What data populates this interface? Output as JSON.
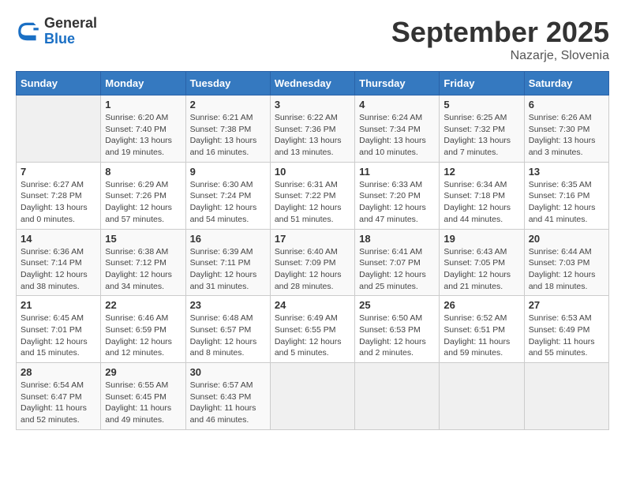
{
  "header": {
    "logo_general": "General",
    "logo_blue": "Blue",
    "month_title": "September 2025",
    "location": "Nazarje, Slovenia"
  },
  "weekdays": [
    "Sunday",
    "Monday",
    "Tuesday",
    "Wednesday",
    "Thursday",
    "Friday",
    "Saturday"
  ],
  "weeks": [
    [
      {
        "day": "",
        "info": ""
      },
      {
        "day": "1",
        "info": "Sunrise: 6:20 AM\nSunset: 7:40 PM\nDaylight: 13 hours and 19 minutes."
      },
      {
        "day": "2",
        "info": "Sunrise: 6:21 AM\nSunset: 7:38 PM\nDaylight: 13 hours and 16 minutes."
      },
      {
        "day": "3",
        "info": "Sunrise: 6:22 AM\nSunset: 7:36 PM\nDaylight: 13 hours and 13 minutes."
      },
      {
        "day": "4",
        "info": "Sunrise: 6:24 AM\nSunset: 7:34 PM\nDaylight: 13 hours and 10 minutes."
      },
      {
        "day": "5",
        "info": "Sunrise: 6:25 AM\nSunset: 7:32 PM\nDaylight: 13 hours and 7 minutes."
      },
      {
        "day": "6",
        "info": "Sunrise: 6:26 AM\nSunset: 7:30 PM\nDaylight: 13 hours and 3 minutes."
      }
    ],
    [
      {
        "day": "7",
        "info": "Sunrise: 6:27 AM\nSunset: 7:28 PM\nDaylight: 13 hours and 0 minutes."
      },
      {
        "day": "8",
        "info": "Sunrise: 6:29 AM\nSunset: 7:26 PM\nDaylight: 12 hours and 57 minutes."
      },
      {
        "day": "9",
        "info": "Sunrise: 6:30 AM\nSunset: 7:24 PM\nDaylight: 12 hours and 54 minutes."
      },
      {
        "day": "10",
        "info": "Sunrise: 6:31 AM\nSunset: 7:22 PM\nDaylight: 12 hours and 51 minutes."
      },
      {
        "day": "11",
        "info": "Sunrise: 6:33 AM\nSunset: 7:20 PM\nDaylight: 12 hours and 47 minutes."
      },
      {
        "day": "12",
        "info": "Sunrise: 6:34 AM\nSunset: 7:18 PM\nDaylight: 12 hours and 44 minutes."
      },
      {
        "day": "13",
        "info": "Sunrise: 6:35 AM\nSunset: 7:16 PM\nDaylight: 12 hours and 41 minutes."
      }
    ],
    [
      {
        "day": "14",
        "info": "Sunrise: 6:36 AM\nSunset: 7:14 PM\nDaylight: 12 hours and 38 minutes."
      },
      {
        "day": "15",
        "info": "Sunrise: 6:38 AM\nSunset: 7:12 PM\nDaylight: 12 hours and 34 minutes."
      },
      {
        "day": "16",
        "info": "Sunrise: 6:39 AM\nSunset: 7:11 PM\nDaylight: 12 hours and 31 minutes."
      },
      {
        "day": "17",
        "info": "Sunrise: 6:40 AM\nSunset: 7:09 PM\nDaylight: 12 hours and 28 minutes."
      },
      {
        "day": "18",
        "info": "Sunrise: 6:41 AM\nSunset: 7:07 PM\nDaylight: 12 hours and 25 minutes."
      },
      {
        "day": "19",
        "info": "Sunrise: 6:43 AM\nSunset: 7:05 PM\nDaylight: 12 hours and 21 minutes."
      },
      {
        "day": "20",
        "info": "Sunrise: 6:44 AM\nSunset: 7:03 PM\nDaylight: 12 hours and 18 minutes."
      }
    ],
    [
      {
        "day": "21",
        "info": "Sunrise: 6:45 AM\nSunset: 7:01 PM\nDaylight: 12 hours and 15 minutes."
      },
      {
        "day": "22",
        "info": "Sunrise: 6:46 AM\nSunset: 6:59 PM\nDaylight: 12 hours and 12 minutes."
      },
      {
        "day": "23",
        "info": "Sunrise: 6:48 AM\nSunset: 6:57 PM\nDaylight: 12 hours and 8 minutes."
      },
      {
        "day": "24",
        "info": "Sunrise: 6:49 AM\nSunset: 6:55 PM\nDaylight: 12 hours and 5 minutes."
      },
      {
        "day": "25",
        "info": "Sunrise: 6:50 AM\nSunset: 6:53 PM\nDaylight: 12 hours and 2 minutes."
      },
      {
        "day": "26",
        "info": "Sunrise: 6:52 AM\nSunset: 6:51 PM\nDaylight: 11 hours and 59 minutes."
      },
      {
        "day": "27",
        "info": "Sunrise: 6:53 AM\nSunset: 6:49 PM\nDaylight: 11 hours and 55 minutes."
      }
    ],
    [
      {
        "day": "28",
        "info": "Sunrise: 6:54 AM\nSunset: 6:47 PM\nDaylight: 11 hours and 52 minutes."
      },
      {
        "day": "29",
        "info": "Sunrise: 6:55 AM\nSunset: 6:45 PM\nDaylight: 11 hours and 49 minutes."
      },
      {
        "day": "30",
        "info": "Sunrise: 6:57 AM\nSunset: 6:43 PM\nDaylight: 11 hours and 46 minutes."
      },
      {
        "day": "",
        "info": ""
      },
      {
        "day": "",
        "info": ""
      },
      {
        "day": "",
        "info": ""
      },
      {
        "day": "",
        "info": ""
      }
    ]
  ]
}
